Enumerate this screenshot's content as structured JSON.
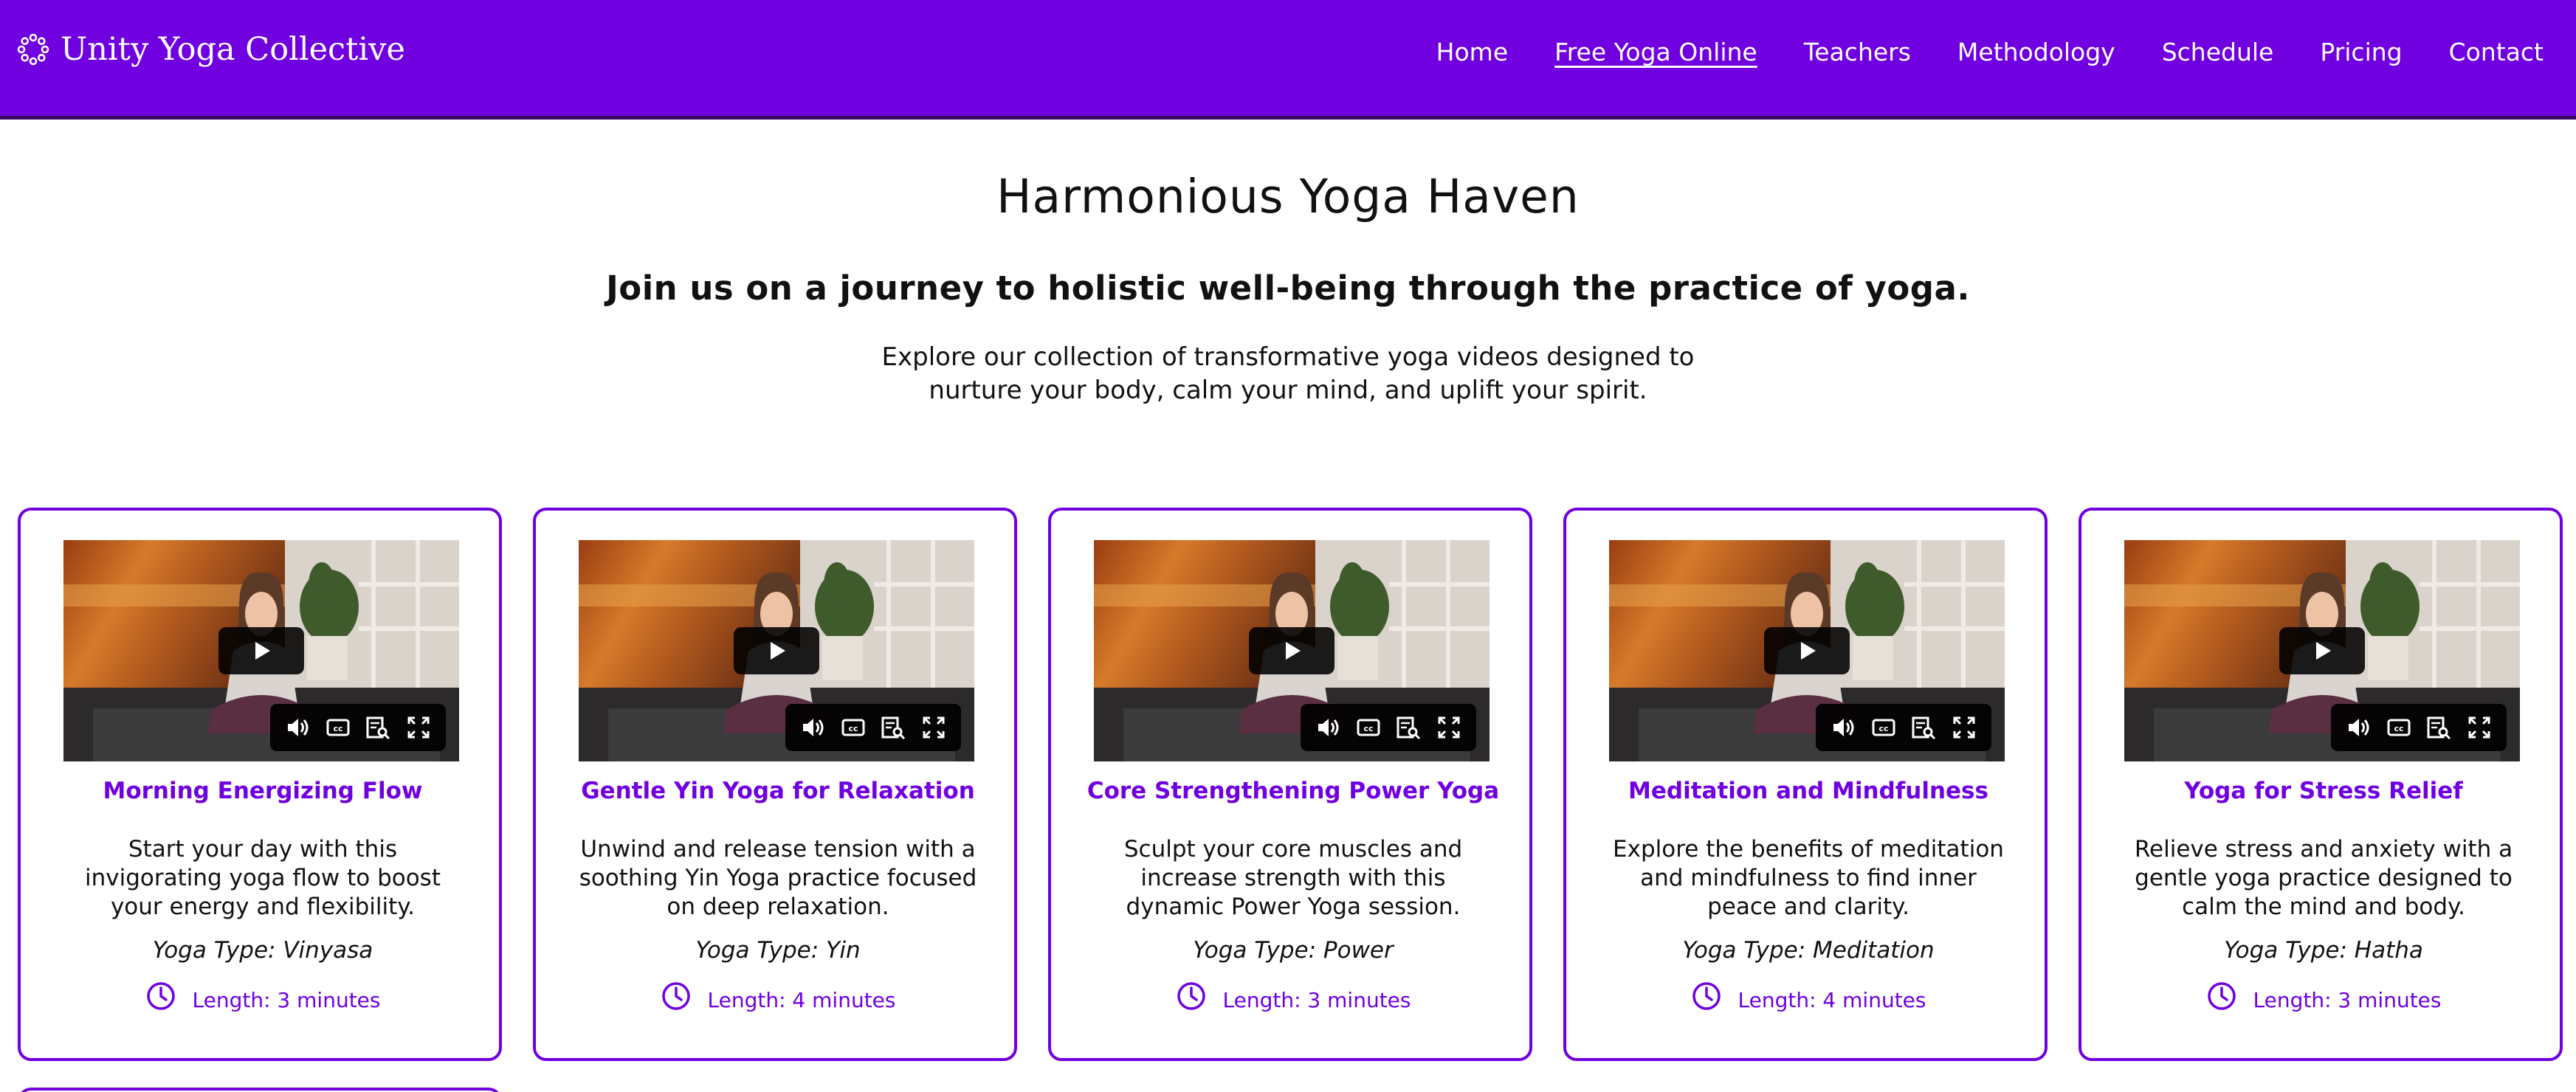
{
  "brand": {
    "name": "Unity Yoga Collective",
    "icon": "lotus-dots-icon"
  },
  "nav": {
    "items": [
      {
        "label": "Home",
        "active": false
      },
      {
        "label": "Free Yoga Online",
        "active": true
      },
      {
        "label": "Teachers",
        "active": false
      },
      {
        "label": "Methodology",
        "active": false
      },
      {
        "label": "Schedule",
        "active": false
      },
      {
        "label": "Pricing",
        "active": false
      },
      {
        "label": "Contact",
        "active": false
      }
    ]
  },
  "hero": {
    "title": "Harmonious Yoga Haven",
    "subtitle": "Join us on a journey to holistic well-being through the practice of yoga.",
    "description": "Explore our collection of transformative yoga videos designed to nurture your body, calm your mind, and uplift your spirit."
  },
  "videos": [
    {
      "title": "Morning Energizing Flow",
      "description": "Start your day with this invigorating yoga flow to boost your energy and flexibility.",
      "type": "Yoga Type: Vinyasa",
      "length": "Length: 3 minutes"
    },
    {
      "title": "Gentle Yin Yoga for Relaxation",
      "description": "Unwind and release tension with a soothing Yin Yoga practice focused on deep relaxation.",
      "type": "Yoga Type: Yin",
      "length": "Length: 4 minutes"
    },
    {
      "title": "Core Strengthening Power Yoga",
      "description": "Sculpt your core muscles and increase strength with this dynamic Power Yoga session.",
      "type": "Yoga Type: Power",
      "length": "Length: 3 minutes"
    },
    {
      "title": "Meditation and Mindfulness",
      "description": "Explore the benefits of meditation and mindfulness to find inner peace and clarity.",
      "type": "Yoga Type: Meditation",
      "length": "Length: 4 minutes"
    },
    {
      "title": "Yoga for Stress Relief",
      "description": "Relieve stress and anxiety with a gentle yoga practice designed to calm the mind and body.",
      "type": "Yoga Type: Hatha",
      "length": "Length: 3 minutes"
    }
  ],
  "colors": {
    "accent": "#7000e0",
    "nav_border": "#3a0a66",
    "text": "#111111",
    "background": "#ffffff"
  }
}
